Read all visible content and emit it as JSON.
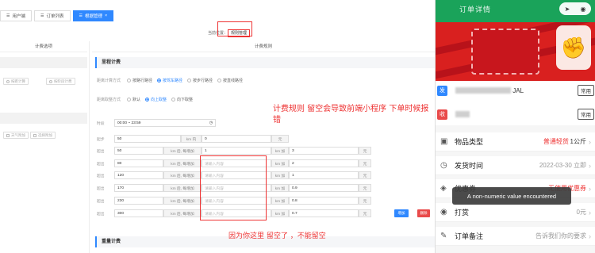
{
  "admin": {
    "tabs": [
      {
        "label": "用户端",
        "icon": "list-icon"
      },
      {
        "label": "订单列表",
        "icon": "list-icon"
      },
      {
        "label": "根据管理",
        "icon": "list-icon",
        "close": "×"
      }
    ],
    "crumb_prefix": "当前位置：",
    "crumb_current": "规则管理",
    "left_head": "计费选项",
    "right_head": "计费规则",
    "left_opts": [
      "按距计算",
      "按阶段计费",
      "天气附加",
      "选择附加"
    ],
    "mileage_section": "里程计费",
    "distance_label": "距离计算方式",
    "distance_options": [
      "按路行路径",
      "按驾车路径",
      "按步行路径",
      "按直线路径"
    ],
    "rounding_label": "距离取整方式",
    "rounding_options": [
      "默认",
      "向上取整",
      "向下取整"
    ],
    "time_label": "时段",
    "time_value": "00:00 ~ 23:59",
    "start_row": {
      "label": "起步",
      "from": "50",
      "unit1": "km 内",
      "price": "0",
      "unit2": "元"
    },
    "rows": [
      {
        "label": "超出",
        "km": "50",
        "unit": "km 后, 每增加",
        "step": "1",
        "unit2": "km 加",
        "price": "3",
        "yuan": "元"
      },
      {
        "label": "超出",
        "km": "80",
        "unit": "km 后, 每增加",
        "step": "请输入内容",
        "unit2": "km 加",
        "price": "2",
        "yuan": "元"
      },
      {
        "label": "超出",
        "km": "120",
        "unit": "km 后, 每增加",
        "step": "请输入内容",
        "unit2": "km 加",
        "price": "1",
        "yuan": "元"
      },
      {
        "label": "超出",
        "km": "170",
        "unit": "km 后, 每增加",
        "step": "请输入内容",
        "unit2": "km 加",
        "price": "0.9",
        "yuan": "元"
      },
      {
        "label": "超出",
        "km": "230",
        "unit": "km 后, 每增加",
        "step": "请输入内容",
        "unit2": "km 加",
        "price": "0.8",
        "yuan": "元"
      },
      {
        "label": "超出",
        "km": "300",
        "unit": "km 后, 每增加",
        "step": "请输入内容",
        "unit2": "km 加",
        "price": "0.7",
        "yuan": "元"
      }
    ],
    "add_button": "增加",
    "delete_button": "删除",
    "weight_section": "重量计费",
    "annotation_top": "计费规则 留空会导致前端小程序  下单时候报错",
    "annotation_bottom": "因为你这里  留空了    ，不能留空"
  },
  "phone": {
    "title": "订单详情",
    "sender_badge": "发",
    "sender_suffix": "JAL",
    "receiver_badge": "收",
    "common_tag": "常用",
    "fields": [
      {
        "icon": "package-icon",
        "label": "物品类型",
        "value_red": "普通轻货",
        "value_dark": "1公斤"
      },
      {
        "icon": "clock-icon",
        "label": "发货时间",
        "value": "2022-03-30 立即"
      },
      {
        "icon": "tag-icon",
        "label": "优惠券",
        "value": "无使用优惠券"
      },
      {
        "icon": "coin-icon",
        "label": "打赏",
        "value": "0元"
      },
      {
        "icon": "note-icon",
        "label": "订单备注",
        "value": "告诉我们你的要求"
      }
    ],
    "toast": "A non-numeric value encountered"
  }
}
